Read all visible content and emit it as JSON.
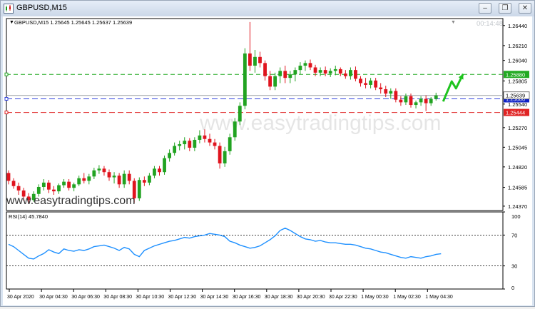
{
  "window": {
    "title": "GBPUSD,M15",
    "buttons": {
      "minimize": "–",
      "restore": "❐",
      "close": "✕"
    }
  },
  "chart_header": {
    "label": "GBPUSD,M15  1.25645 1.25645 1.25637 1.25639",
    "countdown": "00:14:48"
  },
  "watermarks": {
    "main": "www.easytradingtips.com",
    "faded": "www.easytradingtips.com"
  },
  "colors": {
    "bull": "#21a321",
    "bear": "#e0141e",
    "rsi_line": "#1e90ff",
    "take_profit": "#22aa22",
    "entry": "#3344dd",
    "stop_loss": "#e02424",
    "price_tag": "#0d20c6",
    "arrow": "#1ec41e"
  },
  "chart_data": {
    "type": "candlestick",
    "symbol": "GBPUSD",
    "timeframe": "M15",
    "ylim": [
      1.2432,
      1.2652
    ],
    "price_ticks": [
      "1.26440",
      "1.26210",
      "1.26040",
      "1.25805",
      "1.25540",
      "1.25270",
      "1.25045",
      "1.24820",
      "1.24585",
      "1.24370"
    ],
    "x_ticks": [
      "30 Apr 2020",
      "30 Apr 04:30",
      "30 Apr 06:30",
      "30 Apr 08:30",
      "30 Apr 10:30",
      "30 Apr 12:30",
      "30 Apr 14:30",
      "30 Apr 16:30",
      "30 Apr 18:30",
      "30 Apr 20:30",
      "30 Apr 22:30",
      "1 May 00:30",
      "1 May 02:30",
      "1 May 04:30"
    ],
    "levels": [
      {
        "name": "take-profit",
        "price": 1.2588,
        "label": "1.25880"
      },
      {
        "name": "entry",
        "price": 1.256,
        "label": "1.25600"
      },
      {
        "name": "current",
        "price": 1.25639,
        "label": "1.25639"
      },
      {
        "name": "stop-loss",
        "price": 1.25444,
        "label": "1.25444"
      }
    ],
    "candles": [
      [
        1.2475,
        1.2478,
        1.2462,
        1.2466
      ],
      [
        1.2466,
        1.2469,
        1.2457,
        1.246
      ],
      [
        1.246,
        1.2464,
        1.245,
        1.2455
      ],
      [
        1.2455,
        1.2458,
        1.2443,
        1.2448
      ],
      [
        1.2448,
        1.2452,
        1.244,
        1.2444
      ],
      [
        1.2444,
        1.2454,
        1.2442,
        1.2451
      ],
      [
        1.2451,
        1.2462,
        1.2448,
        1.2459
      ],
      [
        1.2459,
        1.2468,
        1.2455,
        1.2464
      ],
      [
        1.2464,
        1.2467,
        1.2452,
        1.2456
      ],
      [
        1.2456,
        1.246,
        1.245,
        1.2454
      ],
      [
        1.2454,
        1.2463,
        1.2451,
        1.2461
      ],
      [
        1.2461,
        1.2468,
        1.2458,
        1.2465
      ],
      [
        1.2465,
        1.2468,
        1.2455,
        1.2458
      ],
      [
        1.2458,
        1.2464,
        1.2454,
        1.2462
      ],
      [
        1.2462,
        1.2472,
        1.246,
        1.2469
      ],
      [
        1.2469,
        1.2475,
        1.2463,
        1.2466
      ],
      [
        1.2466,
        1.2474,
        1.2462,
        1.2471
      ],
      [
        1.2471,
        1.2481,
        1.2468,
        1.2478
      ],
      [
        1.2478,
        1.2484,
        1.2474,
        1.248
      ],
      [
        1.248,
        1.2483,
        1.2472,
        1.2476
      ],
      [
        1.2476,
        1.2479,
        1.2466,
        1.247
      ],
      [
        1.247,
        1.2476,
        1.2463,
        1.2472
      ],
      [
        1.2472,
        1.2475,
        1.2458,
        1.2462
      ],
      [
        1.2462,
        1.2478,
        1.2458,
        1.2474
      ],
      [
        1.2474,
        1.2478,
        1.2462,
        1.2466
      ],
      [
        1.2466,
        1.2469,
        1.2441,
        1.2446
      ],
      [
        1.2446,
        1.247,
        1.2443,
        1.2467
      ],
      [
        1.2467,
        1.2471,
        1.246,
        1.2464
      ],
      [
        1.2464,
        1.2475,
        1.2461,
        1.2472
      ],
      [
        1.2472,
        1.2483,
        1.2469,
        1.248
      ],
      [
        1.248,
        1.2483,
        1.2472,
        1.2476
      ],
      [
        1.2476,
        1.2495,
        1.2473,
        1.2492
      ],
      [
        1.2492,
        1.2502,
        1.2488,
        1.2498
      ],
      [
        1.2498,
        1.251,
        1.2495,
        1.2506
      ],
      [
        1.2506,
        1.2512,
        1.2501,
        1.2508
      ],
      [
        1.2508,
        1.2516,
        1.2502,
        1.2512
      ],
      [
        1.2512,
        1.2515,
        1.25,
        1.2504
      ],
      [
        1.2504,
        1.2516,
        1.25,
        1.2513
      ],
      [
        1.2513,
        1.2524,
        1.2509,
        1.2518
      ],
      [
        1.2518,
        1.2525,
        1.251,
        1.2514
      ],
      [
        1.2514,
        1.252,
        1.2506,
        1.251
      ],
      [
        1.251,
        1.2514,
        1.2502,
        1.2506
      ],
      [
        1.2506,
        1.251,
        1.248,
        1.2486
      ],
      [
        1.2486,
        1.2505,
        1.2482,
        1.25
      ],
      [
        1.25,
        1.252,
        1.2496,
        1.2516
      ],
      [
        1.2516,
        1.2538,
        1.2512,
        1.2534
      ],
      [
        1.2534,
        1.2556,
        1.253,
        1.2552
      ],
      [
        1.2552,
        1.2618,
        1.2548,
        1.2612
      ],
      [
        1.2612,
        1.2648,
        1.2592,
        1.2598
      ],
      [
        1.2598,
        1.2616,
        1.259,
        1.2608
      ],
      [
        1.2608,
        1.2614,
        1.2596,
        1.2601
      ],
      [
        1.2601,
        1.2604,
        1.2581,
        1.2586
      ],
      [
        1.2586,
        1.2592,
        1.257,
        1.2574
      ],
      [
        1.2574,
        1.259,
        1.257,
        1.2586
      ],
      [
        1.2586,
        1.2596,
        1.2578,
        1.2592
      ],
      [
        1.2592,
        1.2598,
        1.2578,
        1.2584
      ],
      [
        1.2584,
        1.2592,
        1.2578,
        1.2588
      ],
      [
        1.2588,
        1.2596,
        1.258,
        1.2593
      ],
      [
        1.2593,
        1.2602,
        1.2588,
        1.2598
      ],
      [
        1.2598,
        1.2604,
        1.2592,
        1.2601
      ],
      [
        1.2601,
        1.2605,
        1.2593,
        1.2596
      ],
      [
        1.2596,
        1.2599,
        1.2586,
        1.259
      ],
      [
        1.259,
        1.2596,
        1.2586,
        1.2593
      ],
      [
        1.2593,
        1.2597,
        1.2586,
        1.2589
      ],
      [
        1.2589,
        1.2595,
        1.2585,
        1.2592
      ],
      [
        1.2592,
        1.2598,
        1.2587,
        1.2594
      ],
      [
        1.2594,
        1.2596,
        1.2586,
        1.2589
      ],
      [
        1.2589,
        1.2593,
        1.2583,
        1.2586
      ],
      [
        1.2586,
        1.2596,
        1.2582,
        1.2593
      ],
      [
        1.2593,
        1.2597,
        1.258,
        1.2583
      ],
      [
        1.2583,
        1.2586,
        1.2574,
        1.2578
      ],
      [
        1.2578,
        1.2584,
        1.2572,
        1.2576
      ],
      [
        1.2576,
        1.2584,
        1.2572,
        1.2581
      ],
      [
        1.2581,
        1.2584,
        1.257,
        1.2573
      ],
      [
        1.2573,
        1.2578,
        1.2566,
        1.2571
      ],
      [
        1.2571,
        1.2575,
        1.2562,
        1.2566
      ],
      [
        1.2566,
        1.2572,
        1.256,
        1.2569
      ],
      [
        1.2569,
        1.2572,
        1.2556,
        1.2559
      ],
      [
        1.2559,
        1.2563,
        1.2552,
        1.2556
      ],
      [
        1.2556,
        1.2566,
        1.2553,
        1.2563
      ],
      [
        1.2563,
        1.2566,
        1.255,
        1.2553
      ],
      [
        1.2553,
        1.2558,
        1.2549,
        1.2556
      ],
      [
        1.2556,
        1.2563,
        1.2552,
        1.256
      ],
      [
        1.256,
        1.2564,
        1.2546,
        1.2555
      ],
      [
        1.2555,
        1.2562,
        1.2552,
        1.256
      ],
      [
        1.256,
        1.2567,
        1.2558,
        1.25639
      ]
    ],
    "rsi": {
      "label": "RSI(14) 45.7840",
      "period": 14,
      "current": 45.784,
      "ylim": [
        0,
        100
      ],
      "levels": [
        30,
        70
      ],
      "tick_labels": [
        "100",
        "70",
        "30",
        "0"
      ],
      "values": [
        58,
        55,
        50,
        45,
        40,
        39,
        43,
        46,
        51,
        48,
        46,
        52,
        50,
        49,
        51,
        50,
        52,
        55,
        56,
        57,
        55,
        53,
        50,
        54,
        52,
        45,
        42,
        50,
        53,
        56,
        58,
        60,
        62,
        63,
        65,
        67,
        66,
        68,
        69,
        70,
        72,
        71,
        70,
        68,
        62,
        60,
        57,
        55,
        53,
        54,
        56,
        60,
        64,
        69,
        76,
        79,
        76,
        72,
        68,
        65,
        64,
        62,
        63,
        61,
        60,
        60,
        59,
        58,
        58,
        57,
        55,
        53,
        52,
        50,
        48,
        47,
        45,
        43,
        41,
        40,
        42,
        41,
        40,
        42,
        43,
        45,
        45.784
      ]
    }
  }
}
